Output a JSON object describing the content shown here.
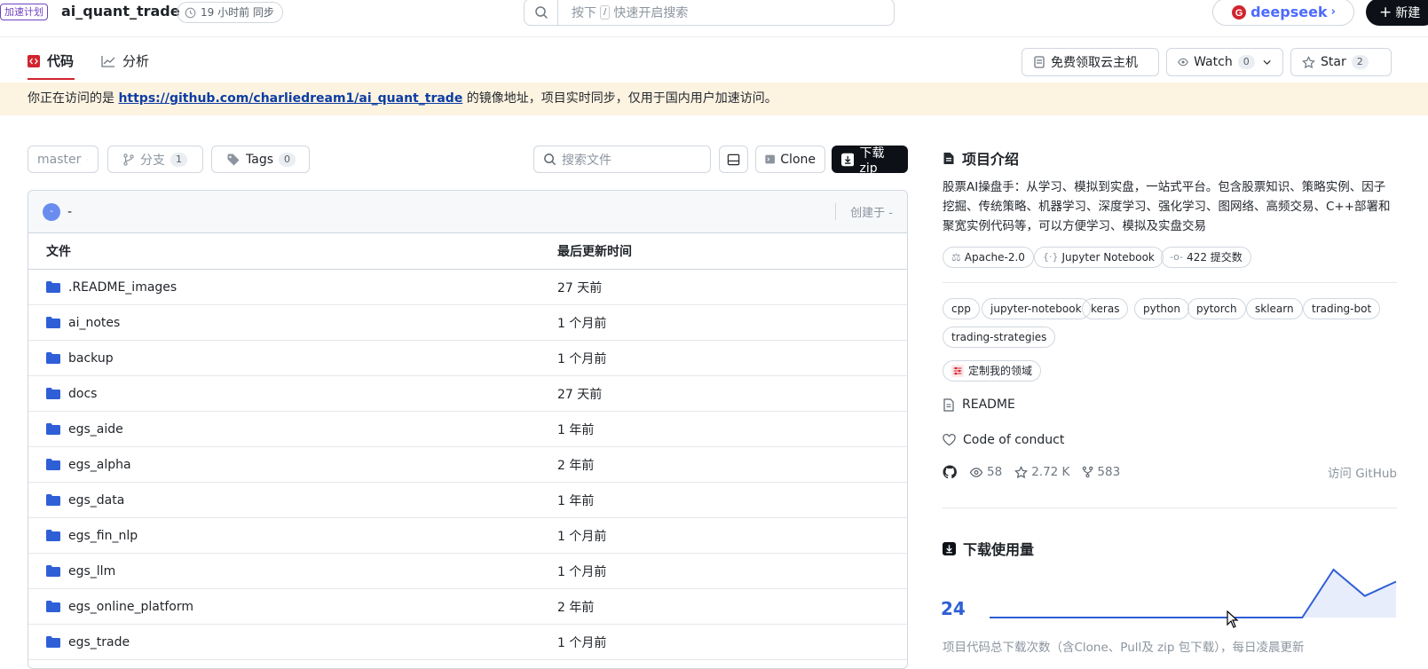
{
  "header": {
    "plan_badge": "加速计划",
    "repo_name": "ai_quant_trade",
    "sync_text": "19 小时前 同步",
    "search_prefix": "按下",
    "search_key": "/",
    "search_placeholder": "快速开启搜索",
    "deepseek_label": "deepseek",
    "new_label": "新建"
  },
  "nav": {
    "tabs": [
      {
        "label": "代码"
      },
      {
        "label": "分析"
      }
    ],
    "cloud_btn": "免费领取云主机",
    "watch_label": "Watch",
    "watch_count": "0",
    "star_label": "Star",
    "star_count": "2"
  },
  "banner": {
    "prefix": "你正在访问的是",
    "link": "https://github.com/charliedream1/ai_quant_trade",
    "suffix": "的镜像地址，项目实时同步，仅用于国内用户加速访问。"
  },
  "toolbar": {
    "branch": "master",
    "branches_label": "分支",
    "branches_count": "1",
    "tags_label": "Tags",
    "tags_count": "0",
    "file_search_placeholder": "搜索文件",
    "clone_label": "Clone",
    "download_label": "下载zip"
  },
  "commit": {
    "avatar_text": "-",
    "message": "-",
    "created": "创建于 -"
  },
  "files": {
    "col_name": "文件",
    "col_updated": "最后更新时间",
    "rows": [
      {
        "name": ".README_images",
        "updated": "27 天前"
      },
      {
        "name": "ai_notes",
        "updated": "1 个月前"
      },
      {
        "name": "backup",
        "updated": "1 个月前"
      },
      {
        "name": "docs",
        "updated": "27 天前"
      },
      {
        "name": "egs_aide",
        "updated": "1 年前"
      },
      {
        "name": "egs_alpha",
        "updated": "2 年前"
      },
      {
        "name": "egs_data",
        "updated": "1 年前"
      },
      {
        "name": "egs_fin_nlp",
        "updated": "1 个月前"
      },
      {
        "name": "egs_llm",
        "updated": "1 个月前"
      },
      {
        "name": "egs_online_platform",
        "updated": "2 年前"
      },
      {
        "name": "egs_trade",
        "updated": "1 个月前"
      }
    ]
  },
  "sidebar": {
    "intro_title": "项目介绍",
    "intro_text": "股票AI操盘手：从学习、模拟到实盘，一站式平台。包含股票知识、策略实例、因子挖掘、传统策略、机器学习、深度学习、强化学习、图网络、高频交易、C++部署和聚宽实例代码等，可以方便学习、模拟及实盘交易",
    "license": "Apache-2.0",
    "language": "Jupyter Notebook",
    "commits": "422 提交数",
    "topics": [
      "cpp",
      "jupyter-notebook",
      "keras",
      "python",
      "pytorch",
      "sklearn",
      "trading-bot",
      "trading-strategies"
    ],
    "customize": "定制我的领域",
    "readme": "README",
    "conduct": "Code of conduct",
    "watchers": "58",
    "stars": "2.72 K",
    "forks": "583",
    "visit_github": "访问 GitHub",
    "download_title": "下载使用量",
    "download_count": "24",
    "download_desc": "项目代码总下载次数（含Clone、Pull及 zip 包下载），每日凌晨更新"
  },
  "colors": {
    "accent": "#d1242f",
    "link": "#0b3da3",
    "chart": "#2f5fd6",
    "banner": "#fdf3e1"
  },
  "chart_data": {
    "type": "line",
    "values": [
      0,
      0,
      0,
      0,
      0,
      0,
      0,
      0,
      0,
      0,
      0,
      1,
      0.45,
      0.75
    ],
    "title": "",
    "xlabel": "",
    "ylabel": ""
  }
}
